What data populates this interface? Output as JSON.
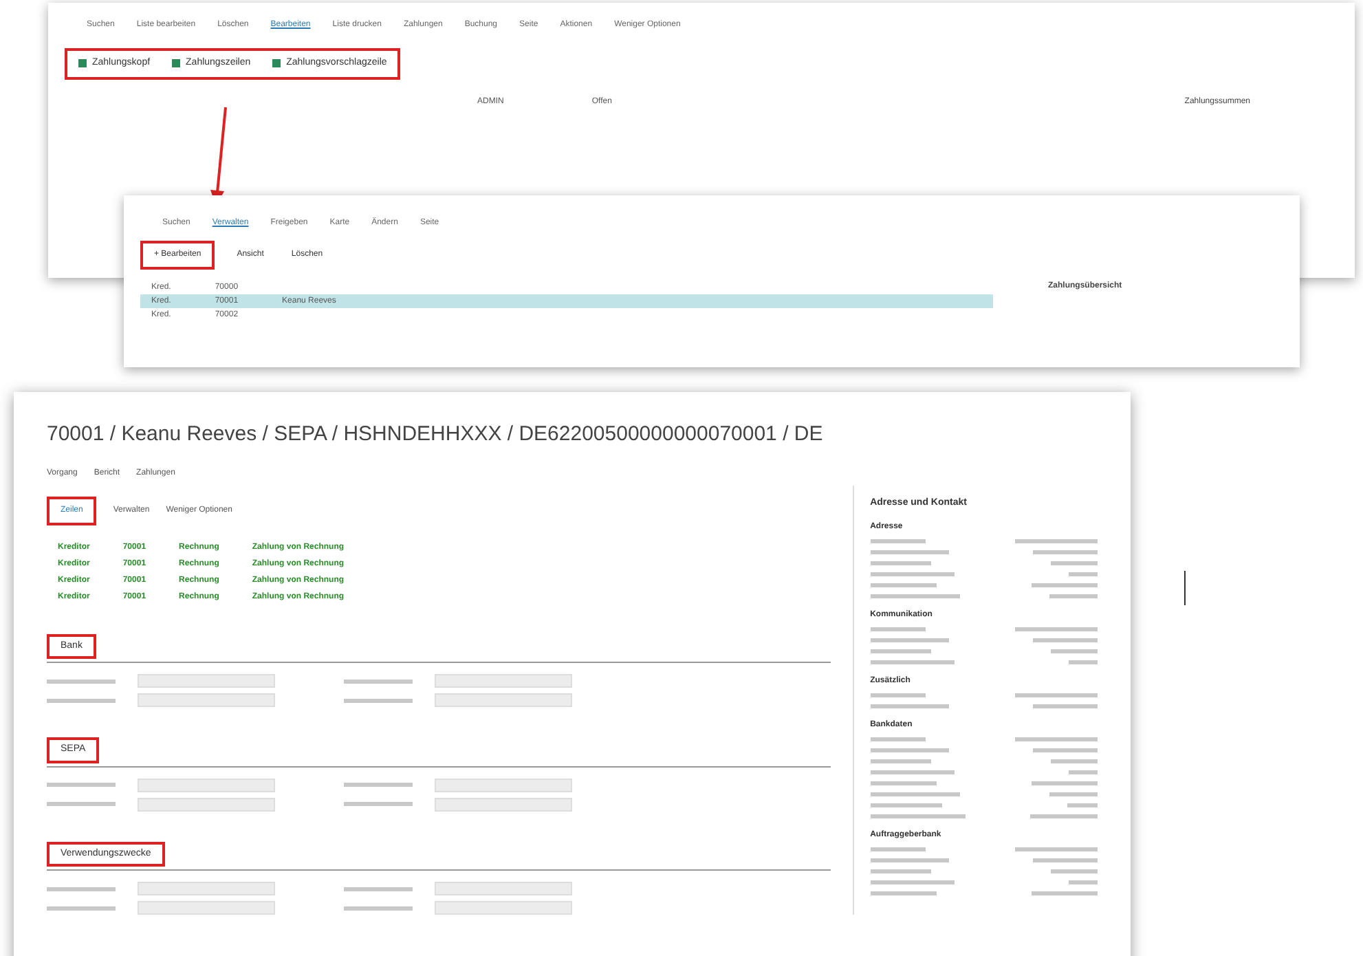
{
  "window_back": {
    "menu": [
      {
        "label": "Suchen",
        "selected": false
      },
      {
        "label": "Liste bearbeiten",
        "selected": false
      },
      {
        "label": "Löschen",
        "selected": false
      },
      {
        "label": "Bearbeiten",
        "selected": true
      },
      {
        "label": "Liste drucken",
        "selected": false
      },
      {
        "label": "Zahlungen",
        "selected": false
      },
      {
        "label": "Buchung",
        "selected": false
      },
      {
        "label": "Seite",
        "selected": false
      },
      {
        "label": "Aktionen",
        "selected": false
      },
      {
        "label": "Weniger Optionen",
        "selected": false
      }
    ],
    "actions": [
      "Zahlungskopf",
      "Zahlungszeilen",
      "Zahlungsvorschlagzeile"
    ],
    "row": [
      "ADMIN",
      "Offen"
    ],
    "factbox_title": "Zahlungssummen"
  },
  "window_middle": {
    "menu": [
      {
        "label": "Suchen",
        "selected": false
      },
      {
        "label": "Verwalten",
        "selected": true
      },
      {
        "label": "Freigeben",
        "selected": false
      },
      {
        "label": "Karte",
        "selected": false
      },
      {
        "label": "Ändern",
        "selected": false
      },
      {
        "label": "Seite",
        "selected": false
      }
    ],
    "actions": [
      {
        "label": "+ Bearbeiten",
        "highlighted": true
      },
      {
        "label": "Ansicht",
        "highlighted": false
      },
      {
        "label": "Löschen",
        "highlighted": false
      }
    ],
    "rows": [
      {
        "cells": [
          "Kred.",
          "70000"
        ],
        "selected": false
      },
      {
        "cells": [
          "Kred.",
          "70001",
          "Keanu Reeves"
        ],
        "selected": true
      },
      {
        "cells": [
          "Kred.",
          "70002"
        ],
        "selected": false
      }
    ],
    "factbox_title": "Zahlungsübersicht"
  },
  "window_front": {
    "title": "70001 / Keanu Reeves / SEPA / HSHNDEHHXXX / DE62200500000000070001 / DE",
    "tabs": [
      "Vorgang",
      "Bericht",
      "Zahlungen"
    ],
    "lines_tabs": [
      {
        "label": "Zeilen",
        "selected": true
      },
      {
        "label": "Verwalten",
        "selected": false
      },
      {
        "label": "Weniger Optionen",
        "selected": false
      }
    ],
    "lines": [
      {
        "cells": [
          "Kreditor",
          "70001",
          "Rechnung",
          "Zahlung von Rechnung"
        ]
      },
      {
        "cells": [
          "Kreditor",
          "70001",
          "Rechnung",
          "Zahlung von Rechnung"
        ]
      },
      {
        "cells": [
          "Kreditor",
          "70001",
          "Rechnung",
          "Zahlung von Rechnung"
        ]
      },
      {
        "cells": [
          "Kreditor",
          "70001",
          "Rechnung",
          "Zahlung von Rechnung"
        ]
      }
    ],
    "sections": [
      {
        "title": "Bank"
      },
      {
        "title": "SEPA"
      },
      {
        "title": "Verwendungszwecke"
      }
    ],
    "factbox": {
      "title": "Adresse und Kontakt",
      "groups": [
        {
          "title": "Adresse"
        },
        {
          "title": "Kommunikation"
        },
        {
          "title": "Zusätzlich"
        },
        {
          "title": "Bankdaten"
        },
        {
          "title": "Auftraggeberbank"
        }
      ]
    }
  }
}
